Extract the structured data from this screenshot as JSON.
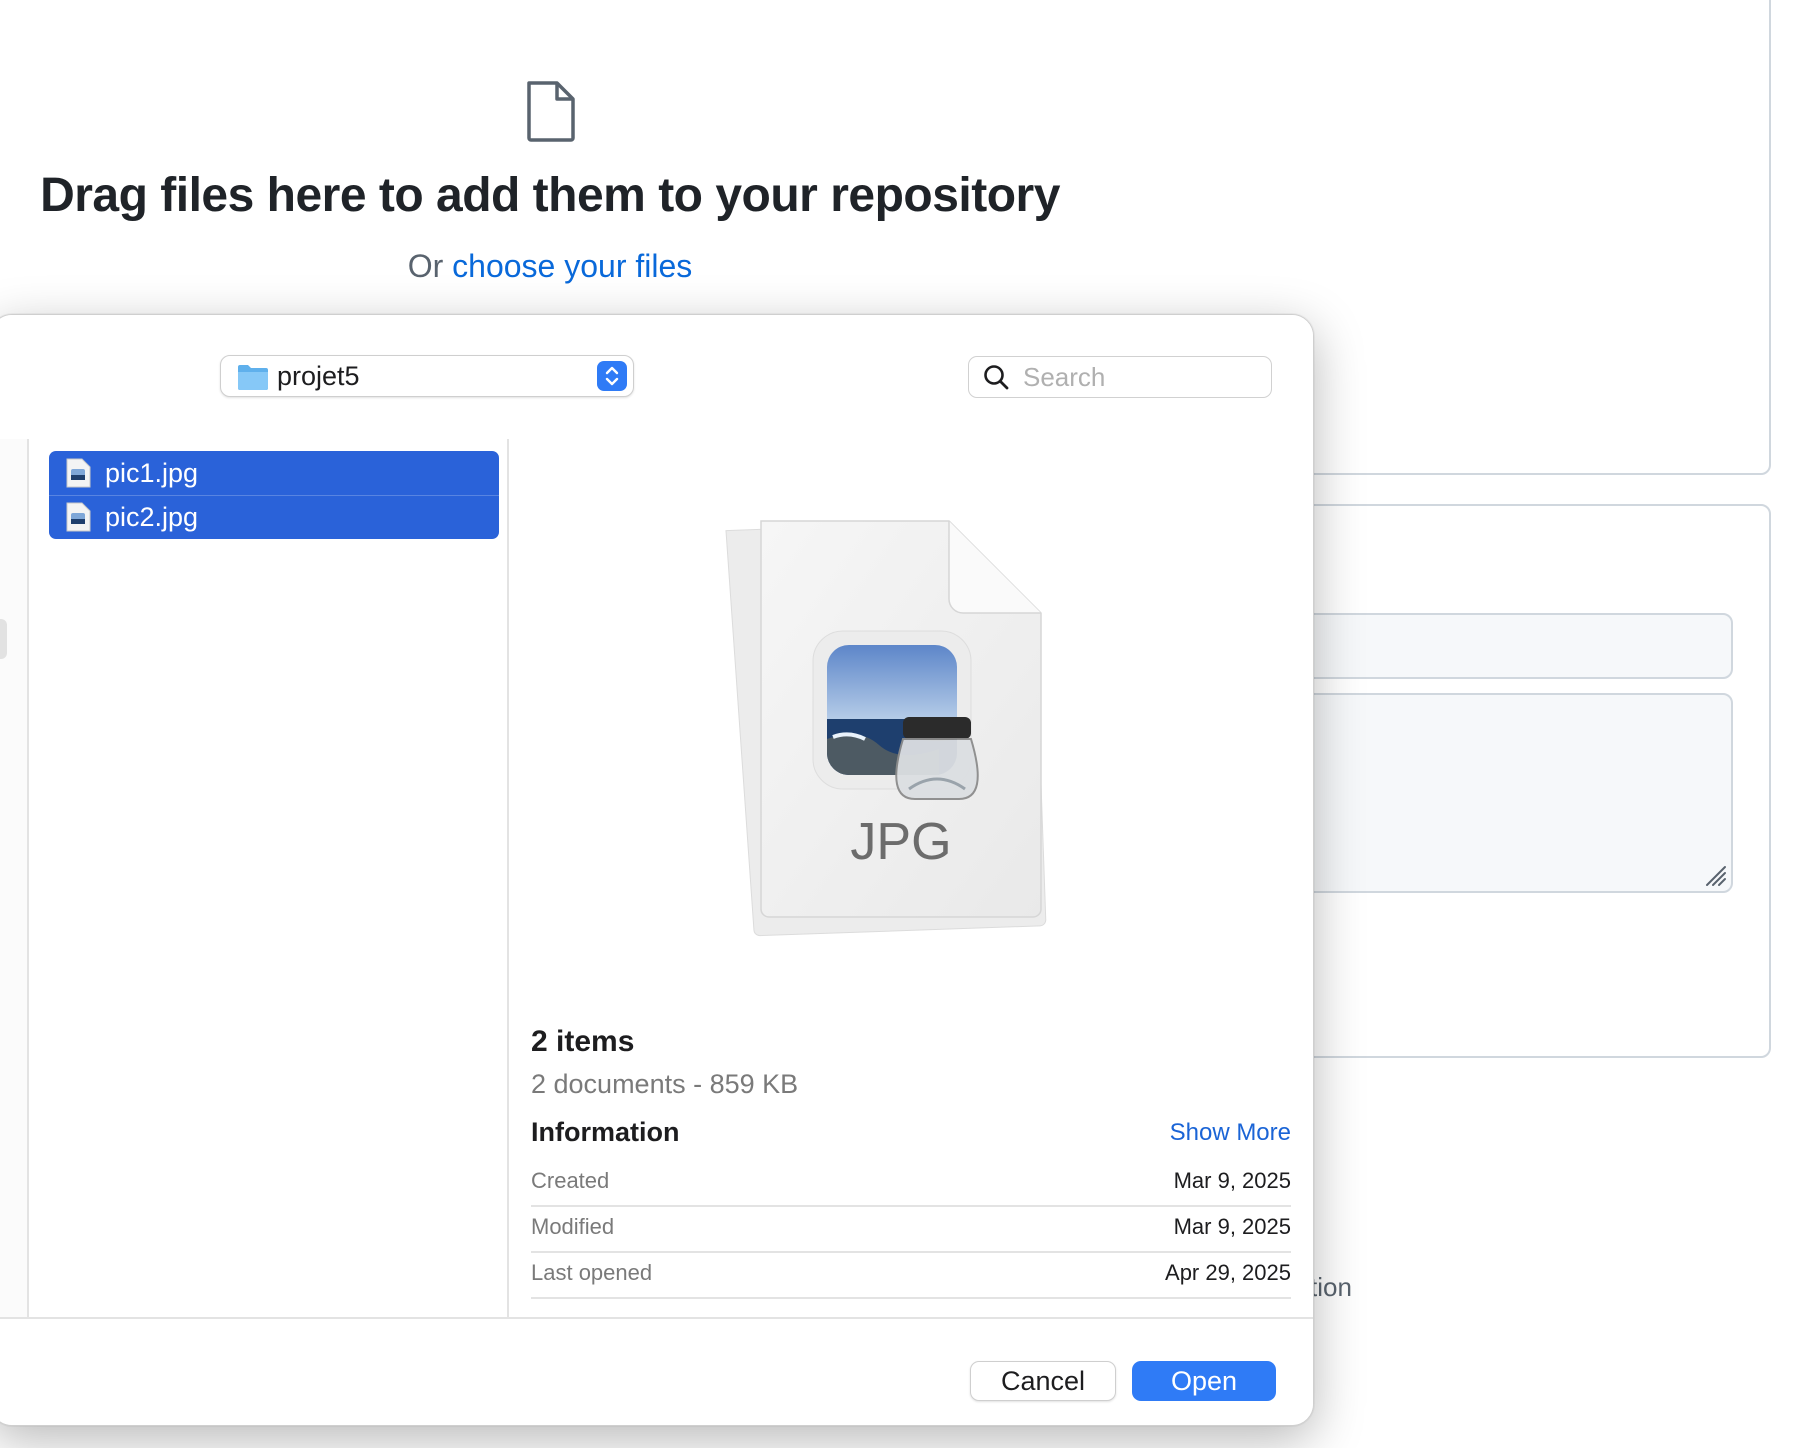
{
  "page": {
    "drag_title": "Drag files here to add them to your repository",
    "choose_prefix": "Or",
    "choose_link": "choose your files",
    "partial_text": "tion"
  },
  "dialog": {
    "location": "projet5",
    "search": {
      "placeholder": "Search",
      "value": ""
    },
    "files": [
      {
        "name": "pic1.jpg",
        "selected": true
      },
      {
        "name": "pic2.jpg",
        "selected": true
      }
    ],
    "preview": {
      "icon_label": "JPG",
      "title": "2 items",
      "subtitle": "2 documents - 859 KB",
      "info_heading": "Information",
      "show_more": "Show More",
      "info": [
        {
          "key": "Created",
          "value": "Mar 9, 2025"
        },
        {
          "key": "Modified",
          "value": "Mar 9, 2025"
        },
        {
          "key": "Last opened",
          "value": "Apr 29, 2025"
        }
      ]
    },
    "buttons": {
      "cancel": "Cancel",
      "open": "Open"
    }
  },
  "colors": {
    "link": "#0969da",
    "selection": "#2a62d9",
    "primary_button": "#2f7bf6",
    "show_more": "#1a64d6"
  },
  "icons": [
    "file-icon",
    "folder-icon",
    "stepper-icon",
    "search-icon",
    "jpg-file-icon",
    "preview-app-icon",
    "resize-grip-icon"
  ]
}
